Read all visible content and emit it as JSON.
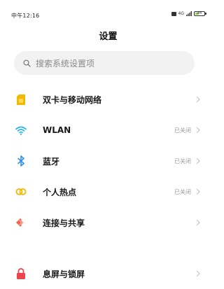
{
  "status_bar": {
    "time": "中午12:16",
    "signal_label": "4G",
    "battery_label": "44",
    "battery_level": 0.44
  },
  "header": {
    "title": "设置"
  },
  "search": {
    "placeholder": "搜索系统设置项"
  },
  "settings": {
    "items": [
      {
        "label": "双卡与移动网络",
        "status": "",
        "icon": "sim-card-icon",
        "color": "#f5b800"
      },
      {
        "label": "WLAN",
        "status": "已关闭",
        "icon": "wifi-icon",
        "color": "#17b3e8"
      },
      {
        "label": "蓝牙",
        "status": "已关闭",
        "icon": "bluetooth-icon",
        "color": "#2f8ff2"
      },
      {
        "label": "个人热点",
        "status": "已关闭",
        "icon": "hotspot-icon",
        "color": "#f5b800"
      },
      {
        "label": "连接与共享",
        "status": "",
        "icon": "connection-share-icon",
        "color": "#f2644e"
      },
      {
        "label": "息屏与锁屏",
        "status": "",
        "icon": "lock-icon",
        "color": "#f0434d"
      }
    ]
  },
  "colors": {
    "chevron": "#c4c4c4",
    "status_text": "#9a9a9a",
    "search_bg": "#f2f2f2"
  }
}
